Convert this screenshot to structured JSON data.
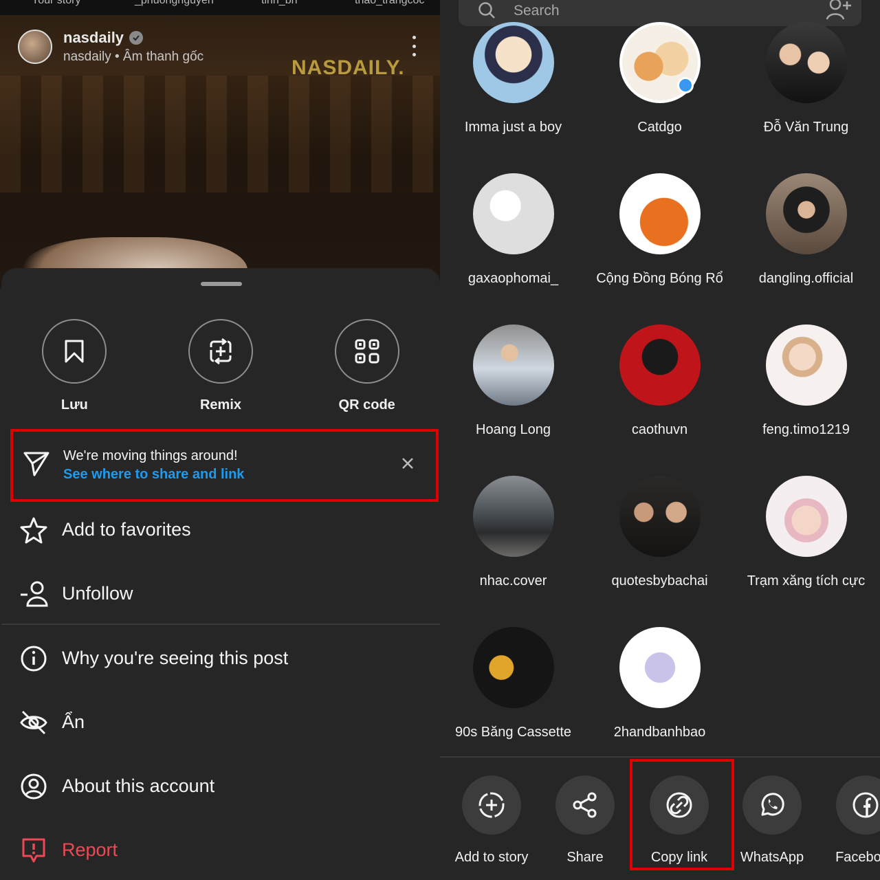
{
  "left_panel": {
    "story_strip": [
      "Your story",
      "_phuongnguyen",
      "tinh_bn",
      "thao_trangcoc"
    ],
    "post": {
      "username": "nasdaily",
      "subtitle": "nasdaily • Âm thanh gốc",
      "watermark": "NASDAILY."
    },
    "top_actions": [
      {
        "label": "Lưu",
        "icon": "bookmark-icon"
      },
      {
        "label": "Remix",
        "icon": "remix-icon"
      },
      {
        "label": "QR code",
        "icon": "qr-code-icon"
      }
    ],
    "notice": {
      "title": "We're moving things around!",
      "link": "See where to share and link"
    },
    "menu": [
      {
        "label": "Add to favorites",
        "icon": "star-icon"
      },
      {
        "label": "Unfollow",
        "icon": "unfollow-icon"
      },
      {
        "label": "Why you're seeing this post",
        "icon": "info-icon"
      },
      {
        "label": "Ẩn",
        "icon": "hide-icon"
      },
      {
        "label": "About this account",
        "icon": "account-icon"
      },
      {
        "label": "Report",
        "icon": "report-icon"
      }
    ]
  },
  "right_panel": {
    "search_placeholder": "Search",
    "contacts": [
      {
        "name": "Imma just a boy"
      },
      {
        "name": "Catdgo"
      },
      {
        "name": "Đỗ Văn Trung"
      },
      {
        "name": "gaxaophomai_"
      },
      {
        "name": "Cộng Đồng Bóng Rổ"
      },
      {
        "name": "dangling.official"
      },
      {
        "name": "Hoang Long"
      },
      {
        "name": "caothuvn"
      },
      {
        "name": "feng.timo1219"
      },
      {
        "name": "nhac.cover"
      },
      {
        "name": "quotesbybachai"
      },
      {
        "name": "Trạm xăng tích cực"
      },
      {
        "name": "90s Băng Cassette"
      },
      {
        "name": "2handbanhbao"
      }
    ],
    "share_apps": [
      {
        "label": "Add to story",
        "icon": "add-story-icon"
      },
      {
        "label": "Share",
        "icon": "share-icon"
      },
      {
        "label": "Copy link",
        "icon": "link-icon"
      },
      {
        "label": "WhatsApp",
        "icon": "whatsapp-icon"
      },
      {
        "label": "Facebook",
        "icon": "facebook-icon"
      }
    ]
  },
  "colors": {
    "background": "#262626",
    "highlight": "#e00000",
    "link_blue": "#1d9bf0",
    "report_red": "#ed4956"
  }
}
